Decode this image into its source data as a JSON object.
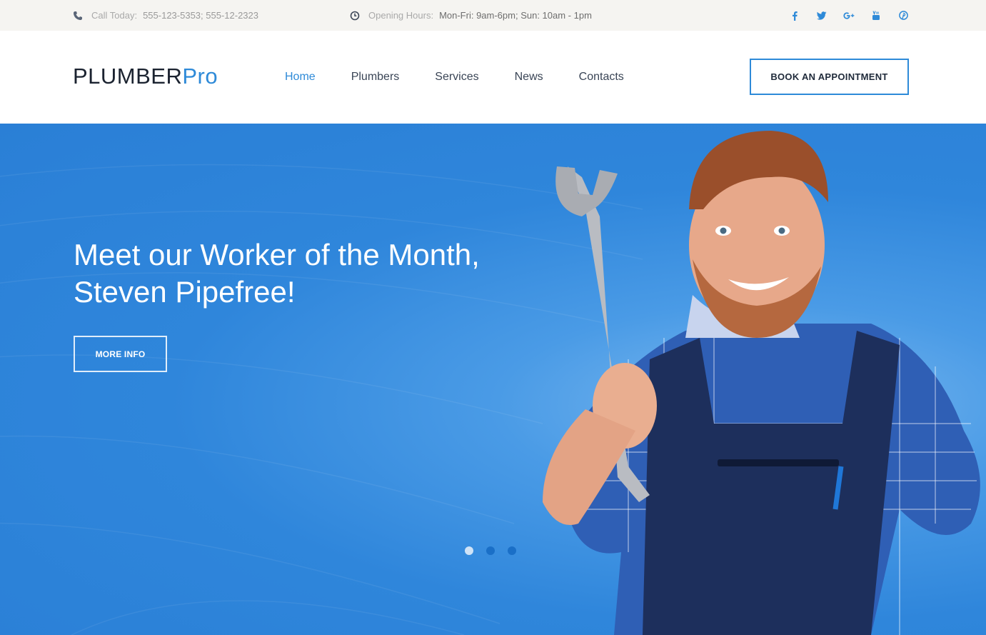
{
  "topbar": {
    "phone_label": "Call Today:",
    "phone_value": "555-123-5353; 555-12-2323",
    "hours_label": "Opening Hours:",
    "hours_value": "Mon-Fri: 9am-6pm; Sun: 10am - 1pm",
    "socials": [
      "facebook-icon",
      "twitter-icon",
      "google-plus-icon",
      "youtube-icon",
      "pinterest-icon"
    ]
  },
  "header": {
    "logo_part1": "PLUMBER",
    "logo_part2": "Pro",
    "nav": [
      {
        "label": "Home",
        "active": true
      },
      {
        "label": "Plumbers"
      },
      {
        "label": "Services"
      },
      {
        "label": "News"
      },
      {
        "label": "Contacts"
      }
    ],
    "cta_label": "BOOK AN APPOINTMENT"
  },
  "hero": {
    "title_line1": "Meet our Worker of the Month,",
    "title_line2": "Steven Pipefree!",
    "button_label": "MORE INFO",
    "slides_count": 3,
    "active_slide": 1
  },
  "colors": {
    "accent": "#2e8ad8",
    "hero_blue": "#2f86db",
    "topbar_bg": "#f5f4f1",
    "text_dark": "#1b2330"
  }
}
